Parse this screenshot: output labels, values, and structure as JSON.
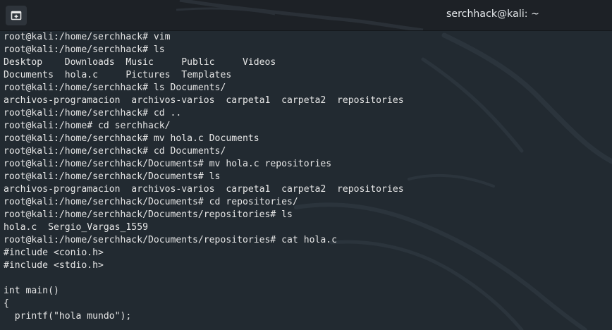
{
  "window": {
    "title": "serchhack@kali: ~",
    "new_tab_icon": "new-tab-icon"
  },
  "terminal": {
    "lines": [
      "root@kali:/home/serchhack# vim",
      "root@kali:/home/serchhack# ls",
      "Desktop    Downloads  Music     Public     Videos",
      "Documents  hola.c     Pictures  Templates",
      "root@kali:/home/serchhack# ls Documents/",
      "archivos-programacion  archivos-varios  carpeta1  carpeta2  repositories",
      "root@kali:/home/serchhack# cd ..",
      "root@kali:/home# cd serchhack/",
      "root@kali:/home/serchhack# mv hola.c Documents",
      "root@kali:/home/serchhack# cd Documents/",
      "root@kali:/home/serchhack/Documents# mv hola.c repositories",
      "root@kali:/home/serchhack/Documents# ls",
      "archivos-programacion  archivos-varios  carpeta1  carpeta2  repositories",
      "root@kali:/home/serchhack/Documents# cd repositories/",
      "root@kali:/home/serchhack/Documents/repositories# ls",
      "hola.c  Sergio_Vargas_1559",
      "root@kali:/home/serchhack/Documents/repositories# cat hola.c",
      "#include <conio.h>",
      "#include <stdio.h>",
      "",
      "int main()",
      "{",
      "  printf(\"hola mundo\");"
    ]
  },
  "colors": {
    "titlebar": "#1d2126",
    "terminal_bg": "#222a31",
    "text": "#e6e6e6"
  }
}
